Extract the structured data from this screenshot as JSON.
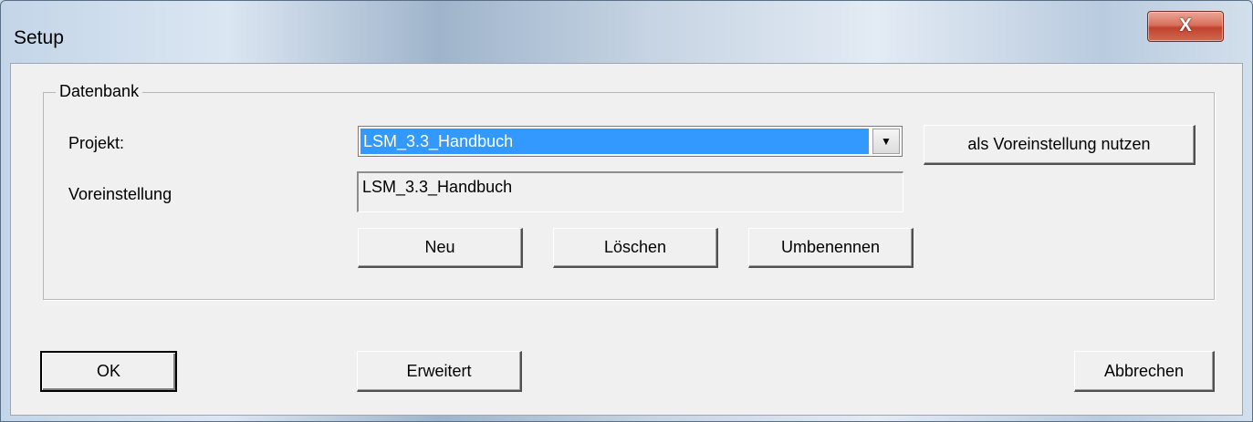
{
  "window": {
    "title": "Setup",
    "close_glyph": "X",
    "close_icon": "close-icon"
  },
  "group": {
    "legend": "Datenbank",
    "projekt_label": "Projekt:",
    "projekt_value": "LSM_3.3_Handbuch",
    "dropdown_glyph": "▼",
    "voreinstellung_label": "Voreinstellung",
    "voreinstellung_value": "LSM_3.3_Handbuch",
    "set_default_label": "als Voreinstellung nutzen",
    "new_label": "Neu",
    "delete_label": "Löschen",
    "rename_label": "Umbenennen"
  },
  "footer": {
    "ok_label": "OK",
    "advanced_label": "Erweitert",
    "cancel_label": "Abbrechen"
  }
}
